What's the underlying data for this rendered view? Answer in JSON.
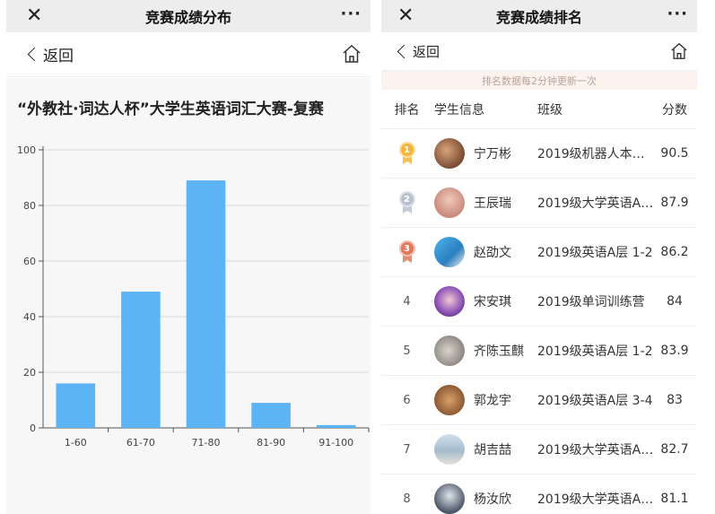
{
  "left": {
    "window_title": "竞赛成绩分布",
    "close_label": "✕",
    "more_label": "···",
    "back_label": "返回",
    "chart_title": "“外教社·词达人杯”大学生英语词汇大赛-复赛"
  },
  "chart_data": {
    "type": "bar",
    "title": "“外教社·词达人杯”大学生英语词汇大赛-复赛",
    "categories": [
      "1-60",
      "61-70",
      "71-80",
      "81-90",
      "91-100"
    ],
    "values": [
      16,
      49,
      89,
      9,
      1
    ],
    "xlabel": "",
    "ylabel": "",
    "ylim": [
      0,
      100
    ],
    "yticks": [
      0,
      20,
      40,
      60,
      80,
      100
    ],
    "grid": true,
    "color": "#5cb3f5"
  },
  "right": {
    "window_title": "竞赛成绩排名",
    "close_label": "✕",
    "more_label": "···",
    "back_label": "返回",
    "notice": "排名数据每2分钟更新一次",
    "headers": {
      "rank": "排名",
      "user": "学生信息",
      "class": "班级",
      "score": "分数"
    },
    "rows": [
      {
        "rank": "1",
        "name": "宁万彬",
        "class": "2019级机器人本…",
        "score": "90.5",
        "medal": "gold"
      },
      {
        "rank": "2",
        "name": "王辰瑞",
        "class": "2019级大学英语A…",
        "score": "87.9",
        "medal": "silver"
      },
      {
        "rank": "3",
        "name": "赵劭文",
        "class": "2019级英语A层 1-2",
        "score": "86.2",
        "medal": "bronze"
      },
      {
        "rank": "4",
        "name": "宋安琪",
        "class": "2019级单词训练营",
        "score": "84"
      },
      {
        "rank": "5",
        "name": "齐陈玉麒",
        "class": "2019级英语A层 1-2",
        "score": "83.9"
      },
      {
        "rank": "6",
        "name": "郭龙宇",
        "class": "2019级英语A层 3-4",
        "score": "83"
      },
      {
        "rank": "7",
        "name": "胡吉喆",
        "class": "2019级大学英语A…",
        "score": "82.7"
      },
      {
        "rank": "8",
        "name": "杨汝欣",
        "class": "2019级大学英语A…",
        "score": "81.1"
      }
    ]
  },
  "colors": {
    "bar": "#5cb3f5",
    "gold": "#f3b63a",
    "silver": "#b9c3cf",
    "bronze": "#e07a5b",
    "notice_bg": "#fdf3ee"
  }
}
